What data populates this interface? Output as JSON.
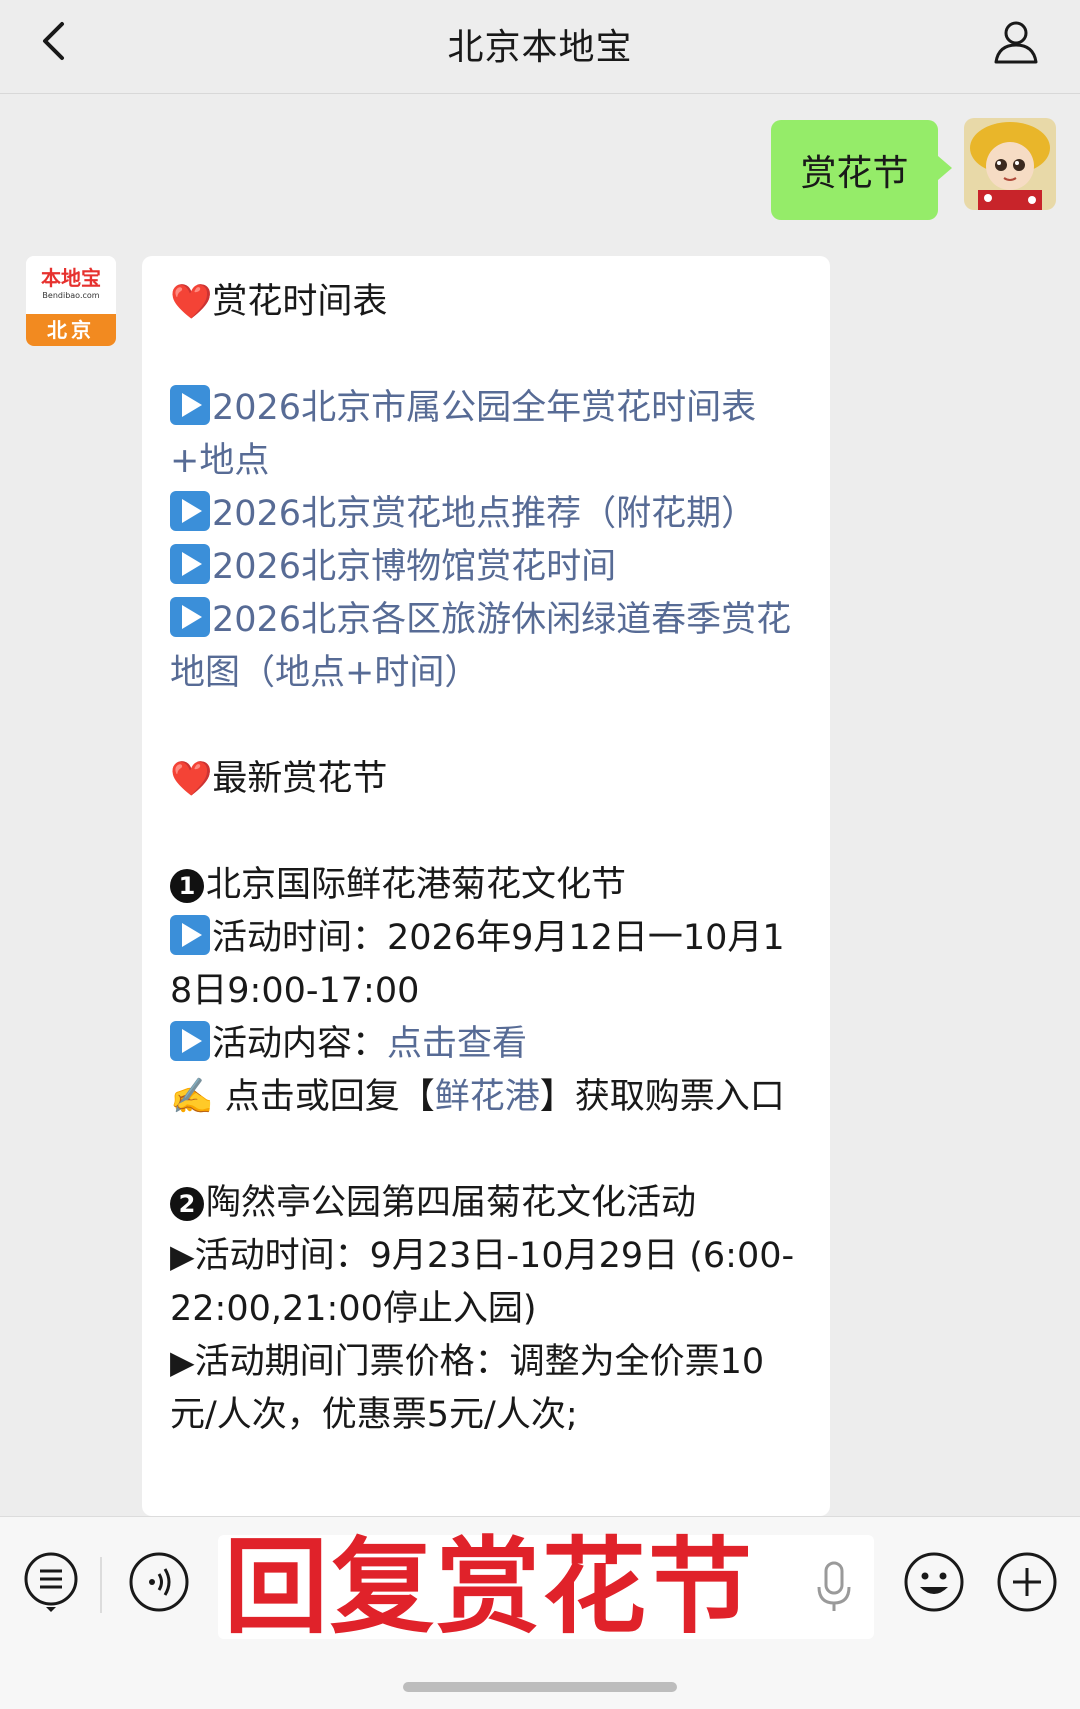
{
  "header": {
    "title": "北京本地宝"
  },
  "user_message": {
    "text": "赏花节"
  },
  "bot": {
    "avatar": {
      "logo_cn": "本地宝",
      "logo_en": "Bendibao.com",
      "city": "北京"
    },
    "section1": {
      "heading": "赏花时间表"
    },
    "links": [
      "2026北京市属公园全年赏花时间表+地点",
      "2026北京赏花地点推荐（附花期）",
      "2026北京博物馆赏花时间",
      "2026北京各区旅游休闲绿道春季赏花地图（地点+时间）"
    ],
    "section2": {
      "heading": "最新赏花节"
    },
    "event1": {
      "number": "1",
      "title": "北京国际鲜花港菊花文化节",
      "time_label": "活动时间：",
      "time_value": "2026年9月12日一10月18日9:00-17:00",
      "content_label": "活动内容：",
      "content_link": "点击查看",
      "reply_prefix": "点击或回复【",
      "reply_keyword": "鲜花港",
      "reply_suffix": "】获取购票入口"
    },
    "event2": {
      "number": "2",
      "title": "陶然亭公园第四届菊花文化活动",
      "time_label": "活动时间：",
      "time_value": "9月23日-10月29日 (6:00-22:00,21:00停止入园)",
      "price_label": "活动期间门票价格：",
      "price_value": "调整为全价票10元/人次，优惠票5元/人次;"
    }
  },
  "input": {
    "text": "回复赏花节"
  },
  "colors": {
    "user_bubble": "#95ec69",
    "link": "#576b95",
    "overlay_text": "#e0222a"
  }
}
